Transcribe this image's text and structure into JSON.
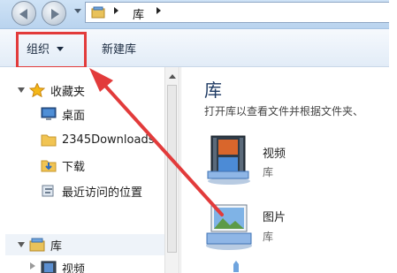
{
  "address_bar": {
    "crumbs": [
      "库"
    ]
  },
  "toolbar": {
    "organize_label": "组织",
    "new_library_label": "新建库"
  },
  "nav_pane": {
    "favorites": {
      "label": "收藏夹",
      "items": [
        {
          "label": "桌面",
          "icon": "desktop-icon"
        },
        {
          "label": "2345Downloads",
          "icon": "folder-icon"
        },
        {
          "label": "下载",
          "icon": "downloads-icon"
        },
        {
          "label": "最近访问的位置",
          "icon": "recent-places-icon"
        }
      ]
    },
    "libraries": {
      "label": "库",
      "items": [
        {
          "label": "视频",
          "icon": "video-library-icon"
        }
      ]
    }
  },
  "content": {
    "title": "库",
    "subtitle": "打开库以查看文件并根据文件夹、",
    "items": [
      {
        "name": "视频",
        "type": "库",
        "icon": "video-library-icon"
      },
      {
        "name": "图片",
        "type": "库",
        "icon": "picture-library-icon"
      }
    ]
  },
  "annotation": {
    "highlight_color": "#e23b3b"
  }
}
